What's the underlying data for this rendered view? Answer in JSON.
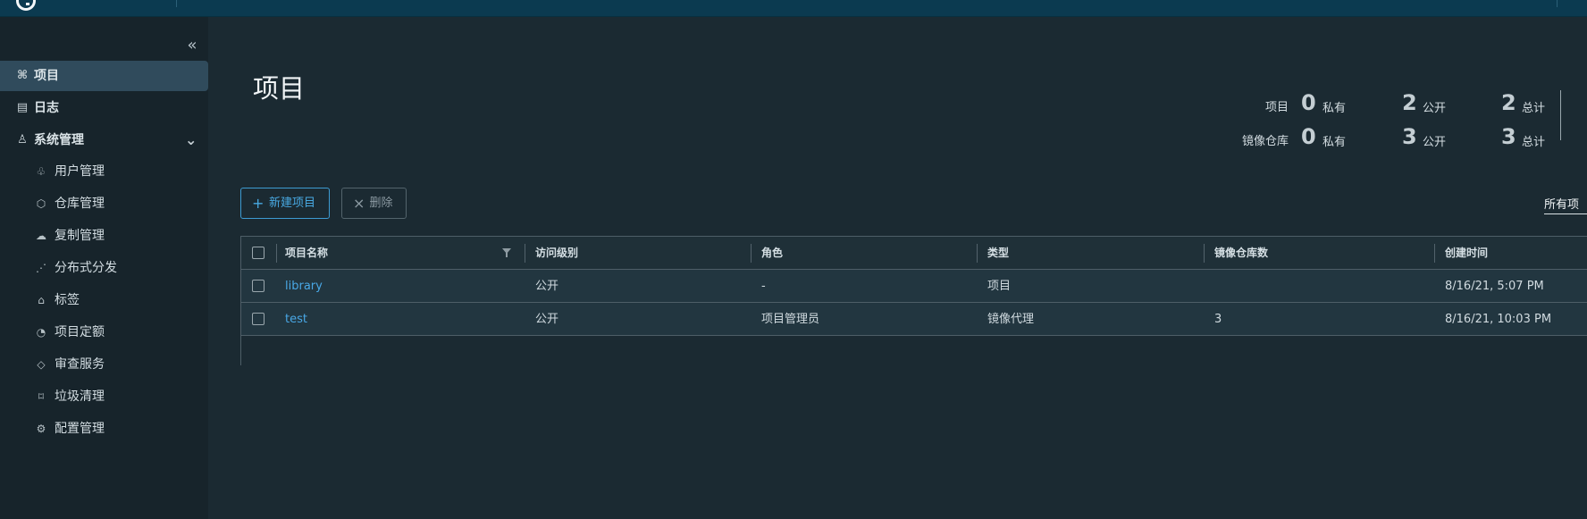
{
  "sidebar": {
    "collapse_icon": "double-chevron-left-icon",
    "items": [
      {
        "label": "项目",
        "icon": "project-tree-icon",
        "active": true
      },
      {
        "label": "日志",
        "icon": "log-icon",
        "active": false
      },
      {
        "label": "系统管理",
        "icon": "system-admin-icon",
        "active": false,
        "expanded": true
      }
    ],
    "subitems": [
      {
        "label": "用户管理",
        "icon": "users-icon"
      },
      {
        "label": "仓库管理",
        "icon": "repository-icon"
      },
      {
        "label": "复制管理",
        "icon": "replication-cloud-icon"
      },
      {
        "label": "分布式分发",
        "icon": "distribution-share-icon"
      },
      {
        "label": "标签",
        "icon": "tag-icon"
      },
      {
        "label": "项目定额",
        "icon": "quota-gauge-icon"
      },
      {
        "label": "审查服务",
        "icon": "shield-icon"
      },
      {
        "label": "垃圾清理",
        "icon": "trash-icon"
      },
      {
        "label": "配置管理",
        "icon": "gear-icon"
      }
    ]
  },
  "main": {
    "title": "项目",
    "summary": {
      "projects": {
        "label": "项目",
        "private_value": "0",
        "private_label": "私有",
        "public_value": "2",
        "public_label": "公开",
        "total_value": "2",
        "total_label": "总计"
      },
      "repositories": {
        "label": "镜像仓库",
        "private_value": "0",
        "private_label": "私有",
        "public_value": "3",
        "public_label": "公开",
        "total_value": "3",
        "total_label": "总计"
      }
    },
    "actions": {
      "new_project": "新建项目",
      "delete": "删除"
    },
    "filter": {
      "label": "所有项"
    },
    "table": {
      "columns": [
        "项目名称",
        "访问级别",
        "角色",
        "类型",
        "镜像仓库数",
        "创建时间"
      ],
      "rows": [
        [
          "library",
          "公开",
          "-",
          "项目",
          "",
          "8/16/21, 5:07 PM"
        ],
        [
          "test",
          "公开",
          "项目管理员",
          "镜像代理",
          "3",
          "8/16/21, 10:03 PM"
        ]
      ]
    }
  },
  "colors": {
    "accent": "#49a8e6",
    "header": "#0b3a50",
    "sidebar": "#17242b",
    "content": "#1b2a32"
  }
}
